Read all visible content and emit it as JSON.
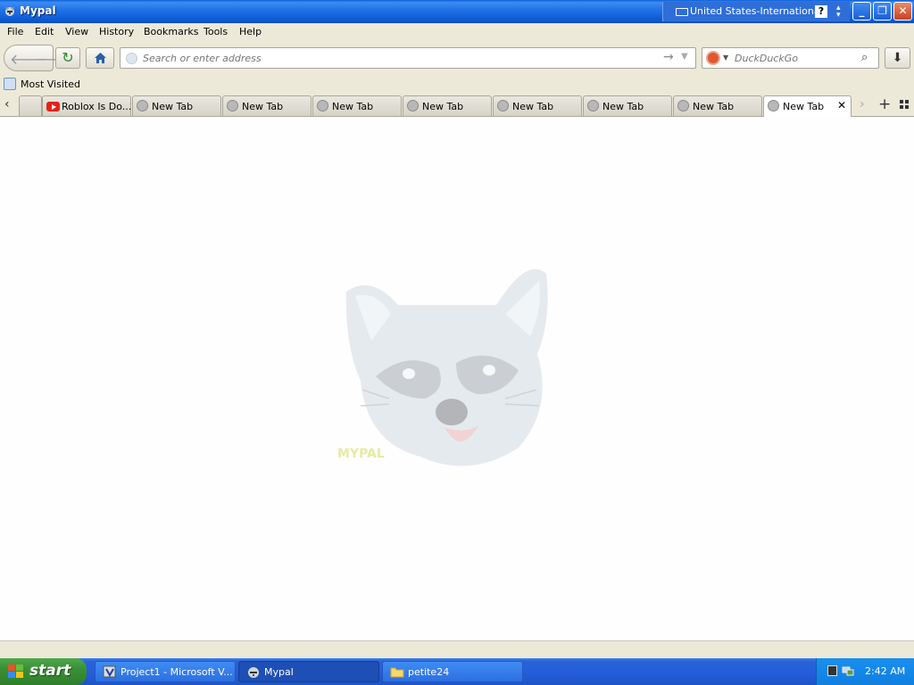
{
  "window": {
    "title": "Mypal",
    "language": "United States-International",
    "language_help": "?",
    "minimize": "_",
    "maximize": "❐",
    "close": "✕"
  },
  "menu": [
    "File",
    "Edit",
    "View",
    "History",
    "Bookmarks",
    "Tools",
    "Help"
  ],
  "nav": {
    "url_placeholder": "Search or enter address",
    "search_placeholder": "DuckDuckGo"
  },
  "bookmarks": {
    "most_visited": "Most Visited"
  },
  "tabs": [
    {
      "label": "Roblox Is Do...",
      "icon": "youtube-icon",
      "active": false
    },
    {
      "label": "New Tab",
      "icon": "globe-icon",
      "active": false
    },
    {
      "label": "New Tab",
      "icon": "globe-icon",
      "active": false
    },
    {
      "label": "New Tab",
      "icon": "globe-icon",
      "active": false
    },
    {
      "label": "New Tab",
      "icon": "globe-icon",
      "active": false
    },
    {
      "label": "New Tab",
      "icon": "globe-icon",
      "active": false
    },
    {
      "label": "New Tab",
      "icon": "globe-icon",
      "active": false
    },
    {
      "label": "New Tab",
      "icon": "globe-icon",
      "active": false
    },
    {
      "label": "New Tab",
      "icon": "globe-icon",
      "active": true
    }
  ],
  "content": {
    "logo_text": "MYPAL"
  },
  "taskbar": {
    "start": "start",
    "tasks": [
      {
        "label": "Project1 - Microsoft V...",
        "icon": "vb-icon",
        "active": false
      },
      {
        "label": "Mypal",
        "icon": "mypal-icon",
        "active": true
      },
      {
        "label": "petite24",
        "icon": "folder-icon",
        "active": false
      }
    ],
    "clock": "2:42 AM"
  },
  "colors": {
    "titlebar": "#0b58d0",
    "chrome": "#ece9d8",
    "taskbar": "#245edb",
    "start": "#3a8f36"
  }
}
